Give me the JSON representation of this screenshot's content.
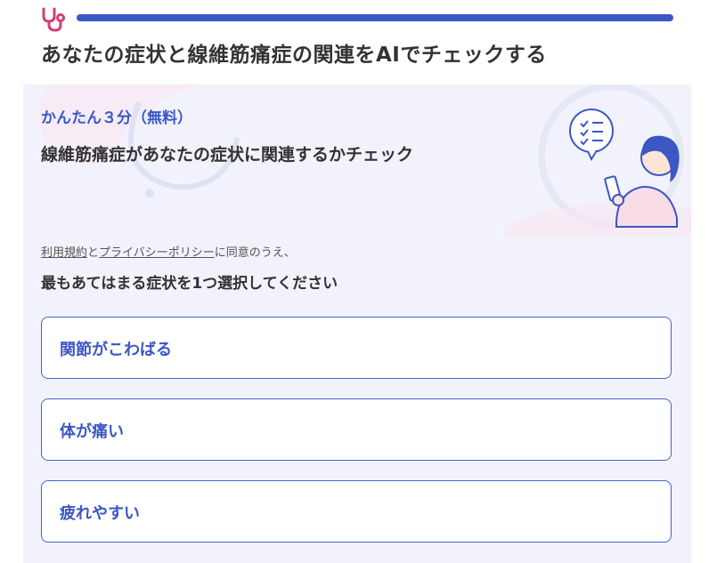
{
  "header": {
    "logo_icon": "stethoscope-icon",
    "accent_color": "#3b57c4",
    "logo_color": "#d63d72",
    "title": "あなたの症状と線維筋痛症の関連をAIでチェックする"
  },
  "intro": {
    "tagline": "かんたん３分（無料）",
    "subtitle": "線維筋痛症があなたの症状に関連するかチェック",
    "illustration": "person-with-phone-checklist-illustration"
  },
  "consent": {
    "terms_link": "利用規約",
    "and": "と",
    "privacy_link": "プライバシーポリシー",
    "suffix": "に同意のうえ、"
  },
  "question": "最もあてはまる症状を1つ選択してください",
  "options": [
    {
      "label": "関節がこわばる"
    },
    {
      "label": "体が痛い"
    },
    {
      "label": "疲れやすい"
    }
  ]
}
